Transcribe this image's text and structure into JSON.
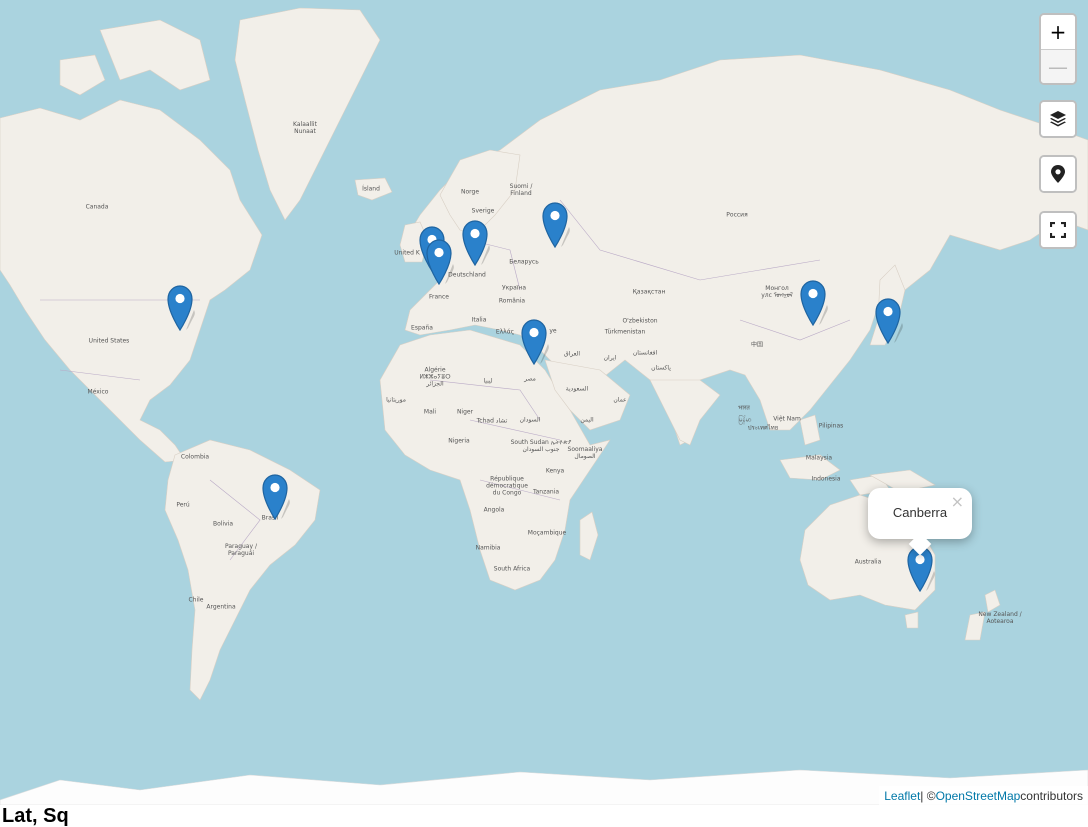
{
  "map": {
    "labels": [
      {
        "id": "kalaallit",
        "text": "Kalaallit\nNunaat"
      },
      {
        "id": "island",
        "text": "Ísland"
      },
      {
        "id": "canada",
        "text": "Canada"
      },
      {
        "id": "norge",
        "text": "Norge"
      },
      {
        "id": "suomi",
        "text": "Suomi /\nFinland"
      },
      {
        "id": "sverige",
        "text": "Sverige"
      },
      {
        "id": "rossiya",
        "text": "Россия"
      },
      {
        "id": "uk",
        "text": "United K"
      },
      {
        "id": "deutschland",
        "text": "Deutschland"
      },
      {
        "id": "belarus",
        "text": "Беларусь"
      },
      {
        "id": "ukraina",
        "text": "Україна"
      },
      {
        "id": "france",
        "text": "France"
      },
      {
        "id": "romania",
        "text": "România"
      },
      {
        "id": "kazakhstan",
        "text": "Қазақстан"
      },
      {
        "id": "mongol",
        "text": "Монгол\nулс ᠮᠣᠩᠭᠣᠯ"
      },
      {
        "id": "usa",
        "text": "United States"
      },
      {
        "id": "espana",
        "text": "España"
      },
      {
        "id": "italia",
        "text": "Italia"
      },
      {
        "id": "ellas",
        "text": "Ελλάς"
      },
      {
        "id": "turkiye",
        "text": "ye"
      },
      {
        "id": "uzbekistan",
        "text": "O'zbekiston"
      },
      {
        "id": "turkmenistan",
        "text": "Türkmenistan"
      },
      {
        "id": "zhongguo",
        "text": "中国"
      },
      {
        "id": "iran",
        "text": "ایران"
      },
      {
        "id": "afghanistan",
        "text": "افغانستان"
      },
      {
        "id": "pakistan",
        "text": "پاکستان"
      },
      {
        "id": "iraq",
        "text": "العراق"
      },
      {
        "id": "mexico",
        "text": "México"
      },
      {
        "id": "algerie",
        "text": "Algérie\nⵍⵣⵣⴰⵢⴻⵔ\nالجزائر"
      },
      {
        "id": "libya",
        "text": "ليبيا"
      },
      {
        "id": "misr",
        "text": "مصر"
      },
      {
        "id": "saudi",
        "text": "السعودية"
      },
      {
        "id": "oman",
        "text": "عمان"
      },
      {
        "id": "mauritania",
        "text": "موريتانيا"
      },
      {
        "id": "mali",
        "text": "Mali"
      },
      {
        "id": "niger",
        "text": "Niger"
      },
      {
        "id": "tchad",
        "text": "Tchad تشاد"
      },
      {
        "id": "sudan",
        "text": "السودان"
      },
      {
        "id": "yemen",
        "text": "اليمن"
      },
      {
        "id": "bharat",
        "text": "भारत"
      },
      {
        "id": "myanmar",
        "text": "မြန်မာ"
      },
      {
        "id": "thailand",
        "text": "ประเทศไทย"
      },
      {
        "id": "vietnam",
        "text": "Việt Nam"
      },
      {
        "id": "pilipinas",
        "text": "Pilipinas"
      },
      {
        "id": "nigeria",
        "text": "Nigeria"
      },
      {
        "id": "southsudan",
        "text": "South Sudan ኢትዮጵያ\nجنوب السودان"
      },
      {
        "id": "somalia",
        "text": "Soomaaliya\nالصومال"
      },
      {
        "id": "colombia",
        "text": "Colombia"
      },
      {
        "id": "malaysia",
        "text": "Malaysia"
      },
      {
        "id": "kenya",
        "text": "Kenya"
      },
      {
        "id": "rdc",
        "text": "République\ndémocratique\ndu Congo"
      },
      {
        "id": "indonesia",
        "text": "Indonesia"
      },
      {
        "id": "peru",
        "text": "Perú"
      },
      {
        "id": "brasil",
        "text": "Brasil"
      },
      {
        "id": "tanzania",
        "text": "Tanzania"
      },
      {
        "id": "bolivia",
        "text": "Bolivia"
      },
      {
        "id": "angola",
        "text": "Angola"
      },
      {
        "id": "mocambique",
        "text": "Moçambique"
      },
      {
        "id": "namibia",
        "text": "Namibia"
      },
      {
        "id": "paraguay",
        "text": "Paraguay /\nParaguái"
      },
      {
        "id": "australia",
        "text": "Australia"
      },
      {
        "id": "southafrica",
        "text": "South Africa"
      },
      {
        "id": "chile",
        "text": "Chile"
      },
      {
        "id": "argentina",
        "text": "Argentina"
      },
      {
        "id": "newzealand",
        "text": "New Zealand /\nAotearoa"
      }
    ]
  },
  "markers": [
    {
      "id": "washington"
    },
    {
      "id": "london"
    },
    {
      "id": "paris"
    },
    {
      "id": "berlin"
    },
    {
      "id": "moscow"
    },
    {
      "id": "cairo"
    },
    {
      "id": "beijing"
    },
    {
      "id": "tokyo"
    },
    {
      "id": "brasilia"
    },
    {
      "id": "canberra"
    }
  ],
  "controls": {
    "zoom_in": "+",
    "zoom_out": "—",
    "layers_icon": "layers-icon",
    "locate_icon": "map-marker-icon",
    "fullscreen_icon": "fullscreen-icon"
  },
  "popup": {
    "text": "Canberra",
    "close": "×"
  },
  "attribution": {
    "leaflet": "Leaflet",
    "sep": " | © ",
    "osm": "OpenStreetMap",
    "rest": " contributors"
  },
  "below_text": "Lat, Sq",
  "colors": {
    "water": "#aad3df",
    "land": "#f2efe9",
    "ice": "#fdfdfd",
    "border": "#b9a9c6",
    "marker": "#2a81cb",
    "link": "#0078a8"
  }
}
